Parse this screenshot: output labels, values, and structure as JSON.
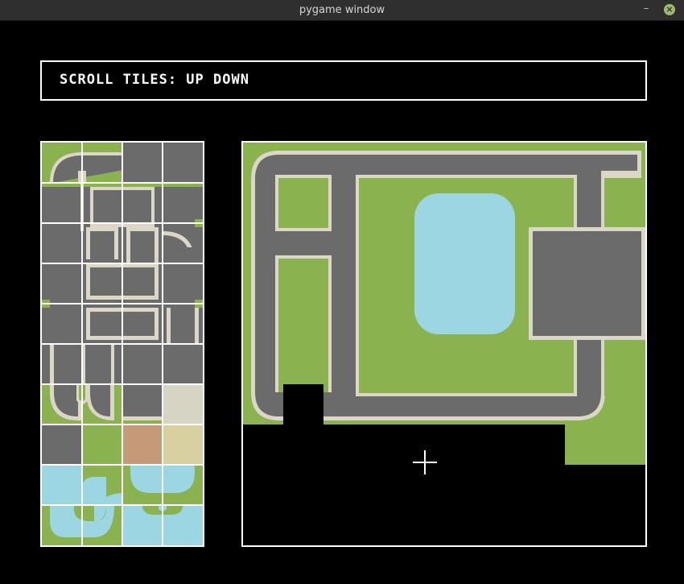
{
  "window": {
    "title": "pygame window",
    "minimize_label": "–",
    "close_label": "×"
  },
  "header": {
    "text": "SCROLL TILES: UP DOWN"
  },
  "colors": {
    "grass": "#8ab24f",
    "road": "#6b6b6b",
    "curb": "#dbd6c6",
    "water": "#9dd6e3",
    "dirt": "#c49a78",
    "sand": "#d8d0a0",
    "concrete": "#d8d4c4",
    "border": "#ffffff",
    "background": "#000000"
  },
  "palette": {
    "columns": 4,
    "rows": 10,
    "tile_kinds": [
      "road-curve",
      "road-straight",
      "road-junction",
      "road-end",
      "grass",
      "dirt",
      "sand",
      "concrete",
      "water-curve",
      "water-straight"
    ]
  },
  "map": {
    "tile_kinds": [
      "road-loop",
      "grass",
      "water-pond",
      "road-block",
      "empty"
    ]
  }
}
